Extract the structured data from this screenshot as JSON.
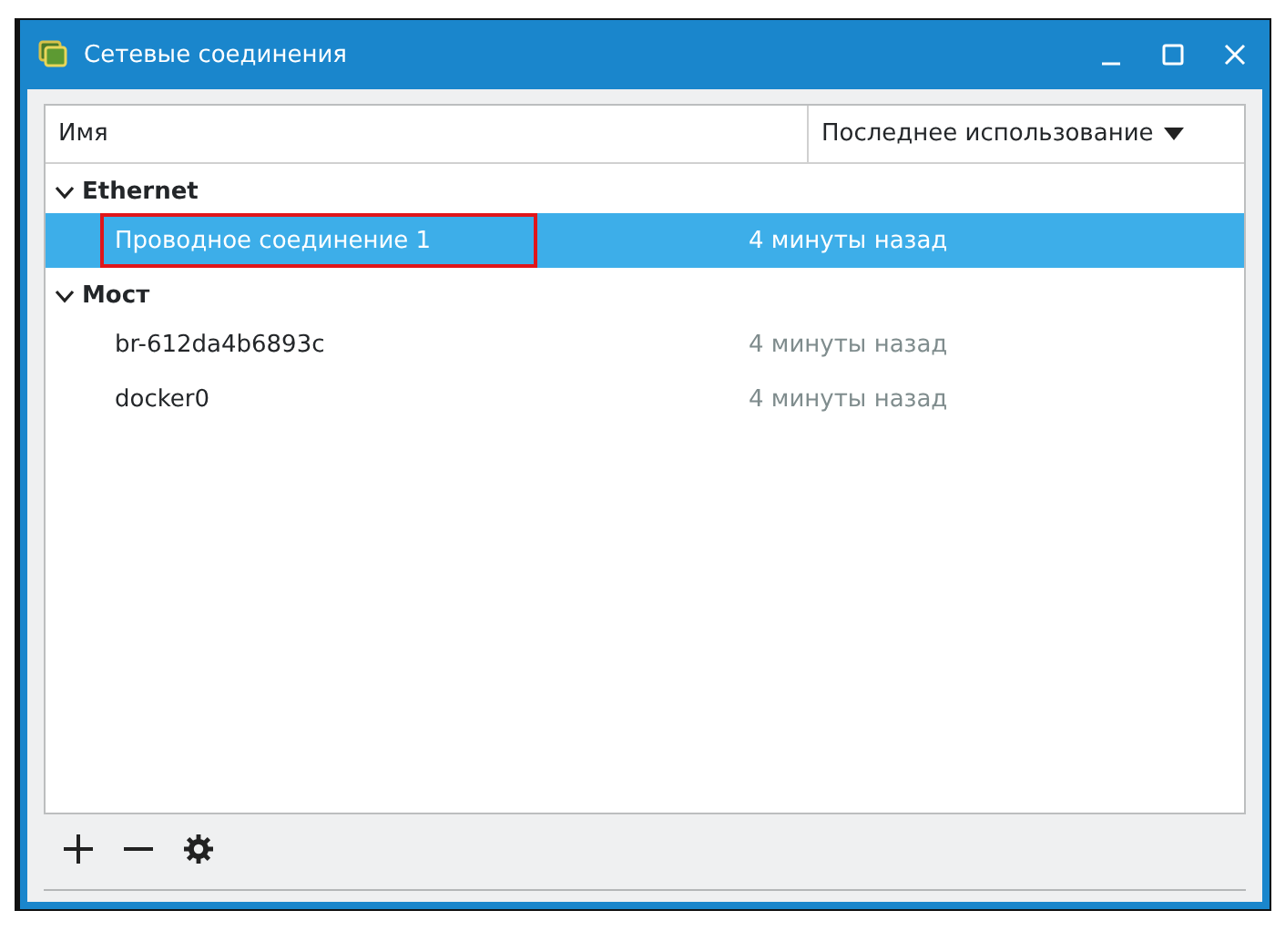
{
  "window": {
    "title": "Сетевые соединения"
  },
  "table": {
    "columns": [
      {
        "label": "Имя",
        "sort_indicator": false
      },
      {
        "label": "Последнее использование",
        "sort_indicator": true
      }
    ],
    "groups": [
      {
        "name": "Ethernet",
        "expanded": true,
        "children": [
          {
            "name": "Проводное соединение 1",
            "last_used": "4 минуты назад",
            "selected": true,
            "highlighted": true
          }
        ]
      },
      {
        "name": "Мост",
        "expanded": true,
        "children": [
          {
            "name": "br-612da4b6893c",
            "last_used": "4 минуты назад",
            "selected": false,
            "highlighted": false
          },
          {
            "name": "docker0",
            "last_used": "4 минуты назад",
            "selected": false,
            "highlighted": false
          }
        ]
      }
    ]
  },
  "toolbar": [
    {
      "kind": "add"
    },
    {
      "kind": "remove"
    },
    {
      "kind": "settings"
    }
  ]
}
